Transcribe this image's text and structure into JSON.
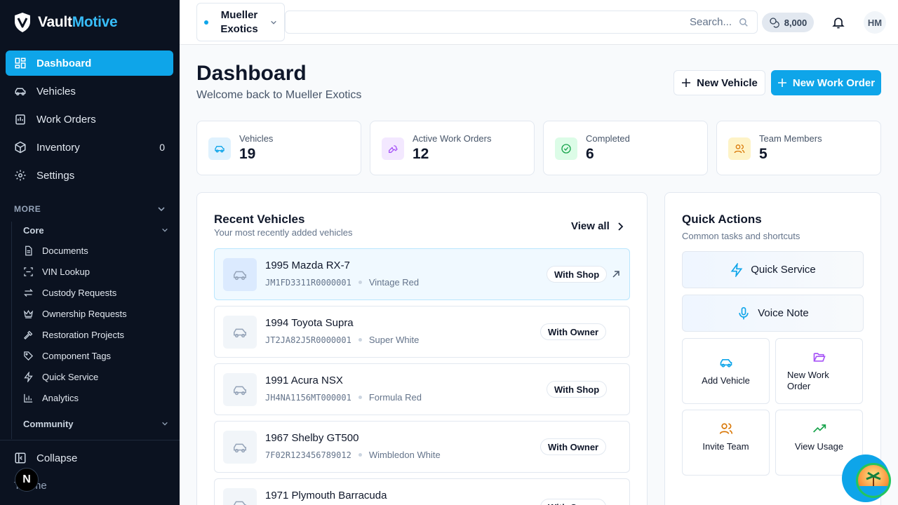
{
  "brand": {
    "name_part1": "Vault",
    "name_part2": "Motive"
  },
  "sidebar": {
    "nav": [
      {
        "label": "Dashboard",
        "icon": "dashboard-icon"
      },
      {
        "label": "Vehicles",
        "icon": "car-icon"
      },
      {
        "label": "Work Orders",
        "icon": "clipboard-icon"
      },
      {
        "label": "Inventory",
        "icon": "box-icon",
        "count": "0"
      },
      {
        "label": "Settings",
        "icon": "gear-icon"
      }
    ],
    "more_label": "MORE",
    "core_label": "Core",
    "core_items": [
      {
        "label": "Documents",
        "icon": "document-icon"
      },
      {
        "label": "VIN Lookup",
        "icon": "scan-icon"
      },
      {
        "label": "Custody Requests",
        "icon": "swap-icon"
      },
      {
        "label": "Ownership Requests",
        "icon": "crown-icon"
      },
      {
        "label": "Restoration Projects",
        "icon": "hammer-icon"
      },
      {
        "label": "Component Tags",
        "icon": "tag-icon"
      },
      {
        "label": "Quick Service",
        "icon": "bolt-icon"
      },
      {
        "label": "Analytics",
        "icon": "chart-icon"
      }
    ],
    "community_label": "Community",
    "collapse_label": "Collapse",
    "theme_label": "Theme",
    "n_badge": "N"
  },
  "topbar": {
    "org_name": "Mueller Exotics",
    "search_placeholder": "Search...",
    "credits": "8,000",
    "avatar_initials": "HM"
  },
  "header": {
    "title": "Dashboard",
    "subtitle": "Welcome back to Mueller Exotics",
    "new_vehicle_label": "New Vehicle",
    "new_work_order_label": "New Work Order"
  },
  "stats": [
    {
      "label": "Vehicles",
      "value": "19",
      "icon": "car-icon",
      "color": "#0ea5e9",
      "bg": "#e0f2fe"
    },
    {
      "label": "Active Work Orders",
      "value": "12",
      "icon": "wrench-icon",
      "color": "#a855f7",
      "bg": "#f3e8ff"
    },
    {
      "label": "Completed",
      "value": "6",
      "icon": "check-circle-icon",
      "color": "#16a34a",
      "bg": "#dcfce7"
    },
    {
      "label": "Team Members",
      "value": "5",
      "icon": "users-icon",
      "color": "#d97706",
      "bg": "#fef3c7"
    }
  ],
  "recent_vehicles": {
    "title": "Recent Vehicles",
    "subtitle": "Your most recently added vehicles",
    "view_all_label": "View all",
    "items": [
      {
        "name": "1995 Mazda RX-7",
        "vin": "JM1FD3311R0000001",
        "color": "Vintage Red",
        "status": "With Shop"
      },
      {
        "name": "1994 Toyota Supra",
        "vin": "JT2JA82J5R0000001",
        "color": "Super White",
        "status": "With Owner"
      },
      {
        "name": "1991 Acura NSX",
        "vin": "JH4NA1156MT000001",
        "color": "Formula Red",
        "status": "With Shop"
      },
      {
        "name": "1967 Shelby GT500",
        "vin": "7F02R123456789012",
        "color": "Wimbledon White",
        "status": "With Owner"
      },
      {
        "name": "1971 Plymouth Barracuda",
        "vin": "",
        "color": "",
        "status": "With Owner"
      }
    ]
  },
  "quick_actions": {
    "title": "Quick Actions",
    "subtitle": "Common tasks and shortcuts",
    "quick_service_label": "Quick Service",
    "voice_note_label": "Voice Note",
    "add_vehicle_label": "Add Vehicle",
    "new_work_order_label": "New Work Order",
    "invite_team_label": "Invite Team",
    "view_usage_label": "View Usage"
  }
}
